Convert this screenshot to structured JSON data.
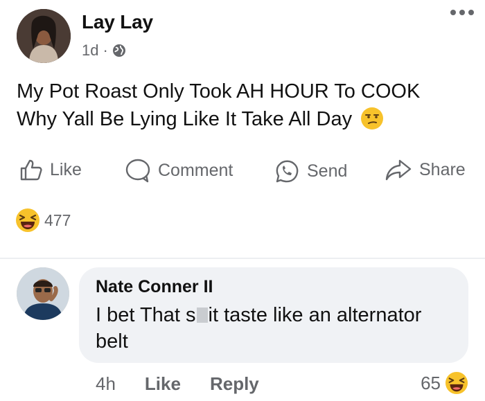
{
  "post": {
    "author": "Lay Lay",
    "time": "1d",
    "separator": "·",
    "audience_icon": "globe-icon",
    "more_icon": "more-dots-icon",
    "text_line1": "My Pot Roast Only Took AH HOUR To COOK",
    "text_line2": "Why Yall Be Lying Like It Take All Day",
    "inline_emoji": "unamused-face-emoji"
  },
  "actions": {
    "like": "Like",
    "comment": "Comment",
    "send": "Send",
    "share": "Share"
  },
  "reactions": {
    "icon": "laughing-emoji",
    "count": "477"
  },
  "comment": {
    "author": "Nate Conner II",
    "text_before": "I bet That s",
    "text_after": "it taste like an alternator belt",
    "time": "4h",
    "like": "Like",
    "reply": "Reply",
    "reaction_count": "65",
    "reaction_icon": "laughing-emoji"
  },
  "colors": {
    "secondary_text": "#65676b",
    "bubble": "#f0f2f5",
    "emoji_yellow": "#f7c22b"
  }
}
